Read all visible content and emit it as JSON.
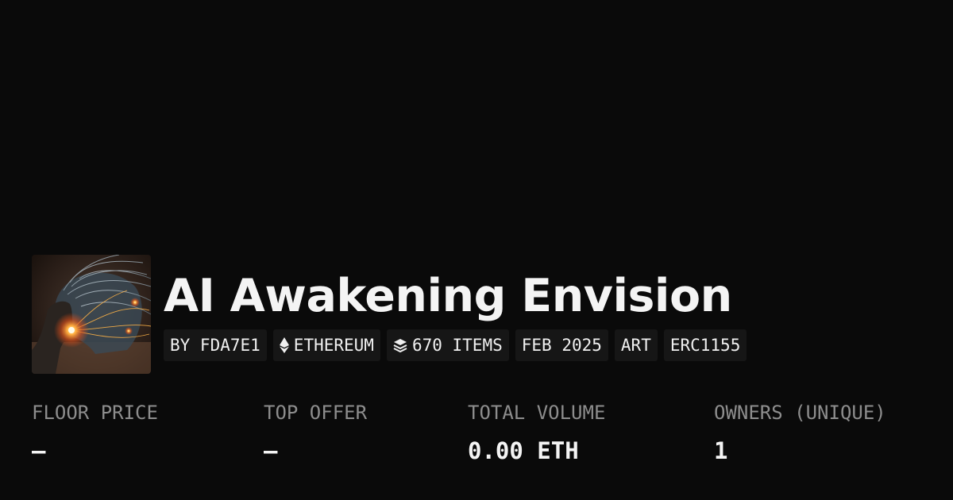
{
  "collection": {
    "name": "AI Awakening Envision",
    "avatar_alt": "glowing-face-artwork"
  },
  "tags": {
    "creator": "BY FDA7E1",
    "chain": "ETHEREUM",
    "chain_icon": "ethereum-icon",
    "items": "670 ITEMS",
    "items_icon": "layers-icon",
    "date": "FEB 2025",
    "category": "ART",
    "standard": "ERC1155"
  },
  "stats": {
    "floor_label": "FLOOR PRICE",
    "floor_value": "–",
    "offer_label": "TOP OFFER",
    "offer_value": "–",
    "volume_label": "TOTAL VOLUME",
    "volume_value": "0.00 ETH",
    "owners_label": "OWNERS (UNIQUE)",
    "owners_value": "1"
  },
  "colors": {
    "background": "#0a0a0a",
    "tag_background": "#161616",
    "label": "#8d8d8d",
    "text": "#f4f4f4",
    "accent_orange": "#ff8a2a"
  }
}
